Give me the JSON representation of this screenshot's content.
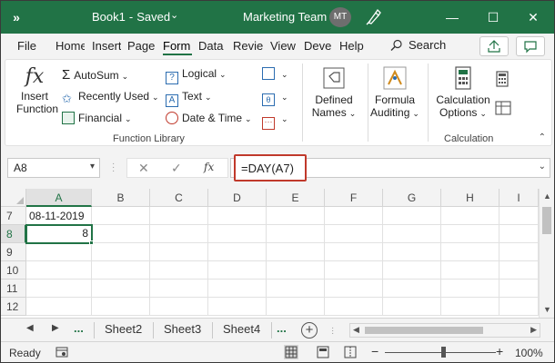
{
  "titlebar": {
    "more": "»",
    "book": "Book1",
    "sep": "-",
    "status": "Saved",
    "team": "Marketing Team",
    "avatar": "MT",
    "min": "—",
    "max": "☐",
    "close": "✕"
  },
  "tabs": [
    "File",
    "Home",
    "Insert",
    "Page",
    "Form",
    "Data",
    "Review",
    "View",
    "Deve",
    "Help"
  ],
  "active_tab": "Form",
  "search_label": "Search",
  "ribbon": {
    "insert_function": [
      "Insert",
      "Function"
    ],
    "autosum": "AutoSum",
    "recently_used": "Recently Used",
    "financial": "Financial",
    "logical": "Logical",
    "text": "Text",
    "date_time": "Date & Time",
    "defined_names": [
      "Defined",
      "Names"
    ],
    "formula_auditing": [
      "Formula",
      "Auditing"
    ],
    "calculation_options": [
      "Calculation",
      "Options"
    ],
    "group_function_library": "Function Library",
    "group_calculation": "Calculation"
  },
  "formula_bar": {
    "name_box": "A8",
    "formula": "=DAY(A7)"
  },
  "grid": {
    "columns": [
      "A",
      "B",
      "C",
      "D",
      "E",
      "F",
      "G",
      "H",
      "I"
    ],
    "rows": [
      "7",
      "8",
      "9",
      "10",
      "11",
      "12"
    ],
    "a7": "08-11-2019",
    "a8": "8"
  },
  "sheets": [
    "Sheet2",
    "Sheet3",
    "Sheet4"
  ],
  "sheet_dots": "...",
  "status": {
    "ready": "Ready",
    "zoom": "100%",
    "minus": "−",
    "plus": "+"
  },
  "colors": {
    "brand": "#217346",
    "highlight": "#c0392b"
  }
}
